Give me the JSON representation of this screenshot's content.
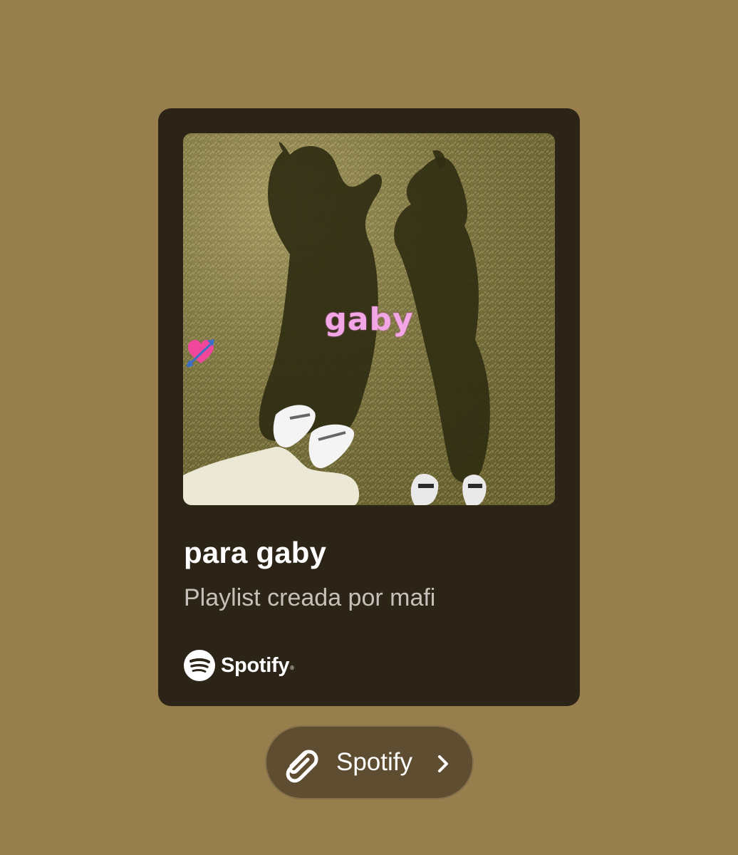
{
  "card": {
    "cover": {
      "overlay_text": "gaby",
      "overlay_emoji": "heart-with-arrow-icon"
    },
    "title": "para gaby",
    "subtitle": "Playlist creada por mafi",
    "brand": {
      "name": "Spotify",
      "registered_mark": "®",
      "icon": "spotify-logo-icon"
    }
  },
  "link_button": {
    "label": "Spotify",
    "leading_icon": "paperclip-icon",
    "trailing_icon": "chevron-right-icon"
  },
  "colors": {
    "background": "#977f4d",
    "card": "#2d2418",
    "pill": "#5e4d31",
    "overlay_text": "#f3a6e6"
  }
}
